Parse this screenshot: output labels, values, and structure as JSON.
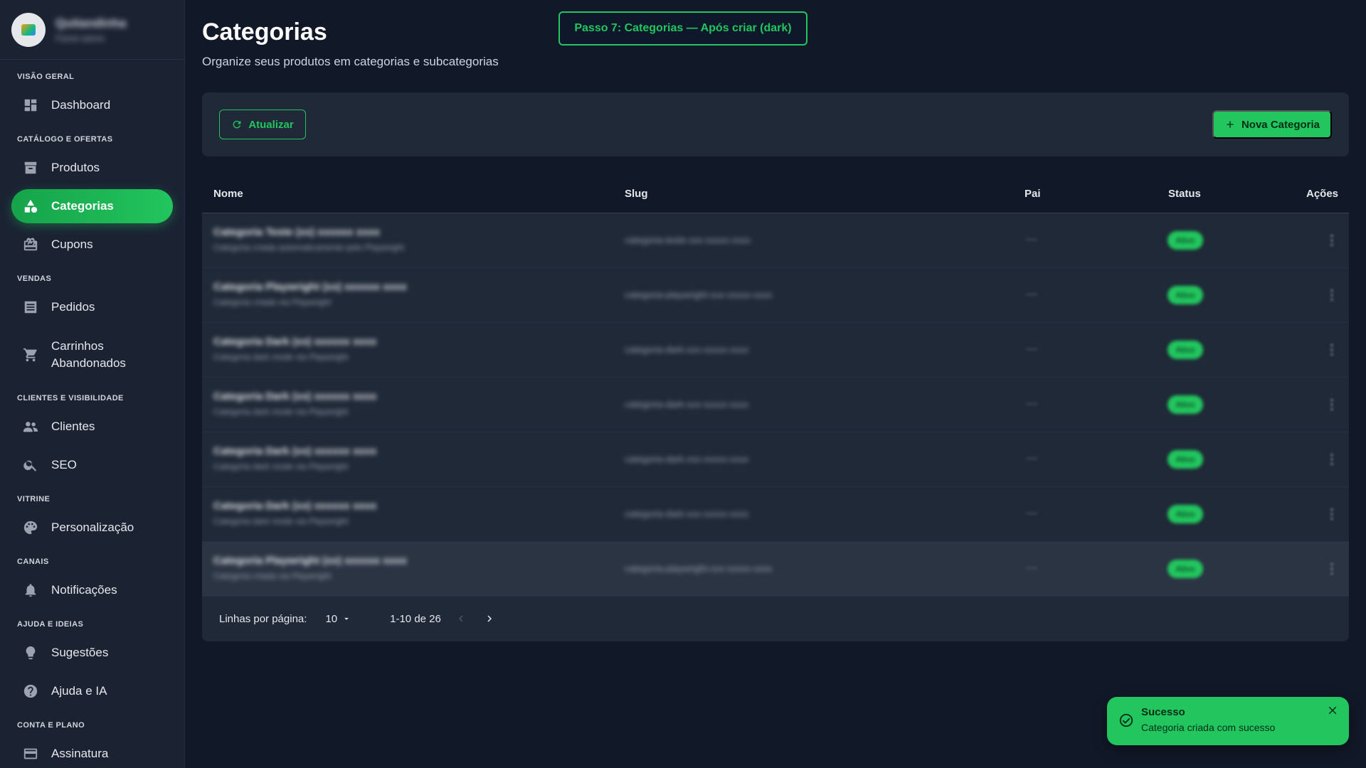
{
  "sidebar": {
    "profile": {
      "name": "Quitandinha",
      "subtitle": "Painel admin"
    },
    "sections": [
      {
        "title": "VISÃO GERAL",
        "items": [
          {
            "label": "Dashboard",
            "icon": "dashboard-icon"
          }
        ]
      },
      {
        "title": "CATÁLOGO E OFERTAS",
        "items": [
          {
            "label": "Produtos",
            "icon": "archive-box-icon"
          },
          {
            "label": "Categorias",
            "icon": "shapes-icon",
            "active": true
          },
          {
            "label": "Cupons",
            "icon": "gift-card-icon"
          }
        ]
      },
      {
        "title": "VENDAS",
        "items": [
          {
            "label": "Pedidos",
            "icon": "receipt-list-icon"
          },
          {
            "label": "Carrinhos Abandonados",
            "icon": "shopping-cart-icon"
          }
        ]
      },
      {
        "title": "CLIENTES E VISIBILIDADE",
        "items": [
          {
            "label": "Clientes",
            "icon": "people-icon"
          },
          {
            "label": "SEO",
            "icon": "search-icon"
          }
        ]
      },
      {
        "title": "VITRINE",
        "items": [
          {
            "label": "Personalização",
            "icon": "palette-icon"
          }
        ]
      },
      {
        "title": "CANAIS",
        "items": [
          {
            "label": "Notificações",
            "icon": "bell-icon"
          }
        ]
      },
      {
        "title": "AJUDA E IDEIAS",
        "items": [
          {
            "label": "Sugestões",
            "icon": "lightbulb-icon"
          },
          {
            "label": "Ajuda e IA",
            "icon": "help-circle-icon"
          }
        ]
      },
      {
        "title": "CONTA E PLANO",
        "items": [
          {
            "label": "Assinatura",
            "icon": "credit-card-icon"
          }
        ]
      }
    ]
  },
  "header": {
    "title": "Categorias",
    "subtitle": "Organize seus produtos em categorias e subcategorias",
    "step_badge": "Passo 7: Categorias — Após criar (dark)"
  },
  "toolbar": {
    "refresh_label": "Atualizar",
    "new_label": "Nova Categoria"
  },
  "table": {
    "columns": {
      "name": "Nome",
      "slug": "Slug",
      "parent": "Pai",
      "status": "Status",
      "actions": "Ações"
    },
    "rows": [
      {
        "name": "Categoria Teste (xx) xxxxxx xxxx",
        "desc": "Categoria criada automaticamente pelo Playwright",
        "slug": "categoria-teste-xxx-xxxxx-xxxx",
        "parent": "—",
        "status": "Ativo"
      },
      {
        "name": "Categoria Playwright (xx) xxxxxx xxxx",
        "desc": "Categoria criada via Playwright",
        "slug": "categoria-playwright-xxx-xxxxx-xxxx",
        "parent": "—",
        "status": "Ativo"
      },
      {
        "name": "Categoria Dark (xx) xxxxxx xxxx",
        "desc": "Categoria dark mode via Playwright",
        "slug": "categoria-dark-xxx-xxxxx-xxxx",
        "parent": "—",
        "status": "Ativo"
      },
      {
        "name": "Categoria Dark (xx) xxxxxx xxxx",
        "desc": "Categoria dark mode via Playwright",
        "slug": "categoria-dark-xxx-xxxxx-xxxx",
        "parent": "—",
        "status": "Ativo"
      },
      {
        "name": "Categoria Dark (xx) xxxxxx xxxx",
        "desc": "Categoria dark mode via Playwright",
        "slug": "categoria-dark-xxx-xxxxx-xxxx",
        "parent": "—",
        "status": "Ativo"
      },
      {
        "name": "Categoria Dark (xx) xxxxxx xxxx",
        "desc": "Categoria dark mode via Playwright",
        "slug": "categoria-dark-xxx-xxxxx-xxxx",
        "parent": "—",
        "status": "Ativo"
      },
      {
        "name": "Categoria Playwright (xx) xxxxxx xxxx",
        "desc": "Categoria criada via Playwright",
        "slug": "categoria-playwright-xxx-xxxxx-xxxx",
        "parent": "—",
        "status": "Ativo"
      }
    ]
  },
  "pagination": {
    "rows_per_page_label": "Linhas por página:",
    "rows_per_page": "10",
    "range": "1-10 de 26"
  },
  "toast": {
    "title": "Sucesso",
    "message": "Categoria criada com sucesso"
  },
  "colors": {
    "accent": "#22c55e",
    "background": "#111827",
    "sidebar": "#1b2333",
    "card": "#1f2937"
  }
}
